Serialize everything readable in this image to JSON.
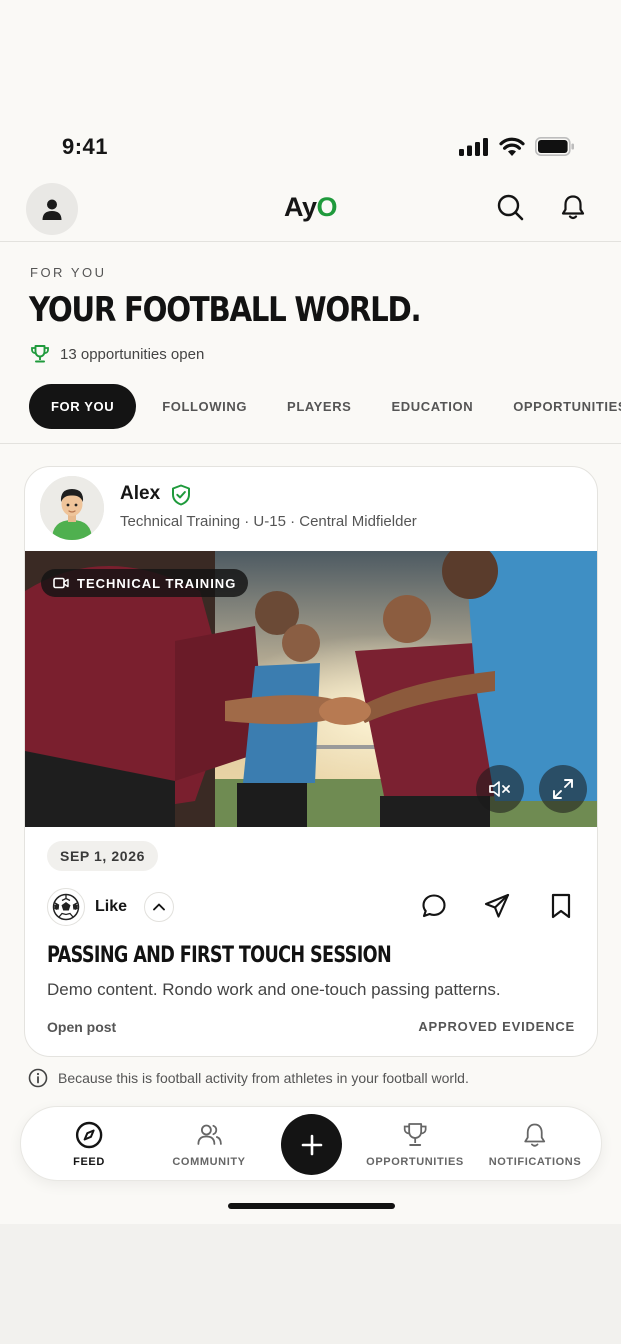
{
  "status_bar": {
    "time": "9:41"
  },
  "header": {
    "logo_main": "Ay",
    "logo_accent": "O"
  },
  "intro": {
    "eyebrow": "FOR YOU",
    "headline": "YOUR FOOTBALL WORLD.",
    "opportunities_text": "13 opportunities open"
  },
  "tabs": [
    {
      "label": "FOR YOU",
      "active": true
    },
    {
      "label": "FOLLOWING",
      "active": false
    },
    {
      "label": "PLAYERS",
      "active": false
    },
    {
      "label": "EDUCATION",
      "active": false
    },
    {
      "label": "OPPORTUNITIES",
      "active": false
    }
  ],
  "post": {
    "author_name": "Alex",
    "author_meta": "Technical Training · U-15 · Central Midfielder",
    "media_badge": "TECHNICAL TRAINING",
    "date": "SEP 1, 2026",
    "like_label": "Like",
    "title": "PASSING AND FIRST TOUCH SESSION",
    "body": "Demo content. Rondo work and one-touch passing patterns.",
    "open_post": "Open post",
    "evidence": "APPROVED EVIDENCE"
  },
  "reason_text": "Because this is football activity from athletes in your football world.",
  "bottom_nav": {
    "feed": "FEED",
    "community": "COMMUNITY",
    "opportunities": "OPPORTUNITIES",
    "notifications": "NOTIFICATIONS"
  },
  "colors": {
    "accent": "#1f9a3c",
    "dark": "#141414",
    "background": "#faf9f6"
  }
}
